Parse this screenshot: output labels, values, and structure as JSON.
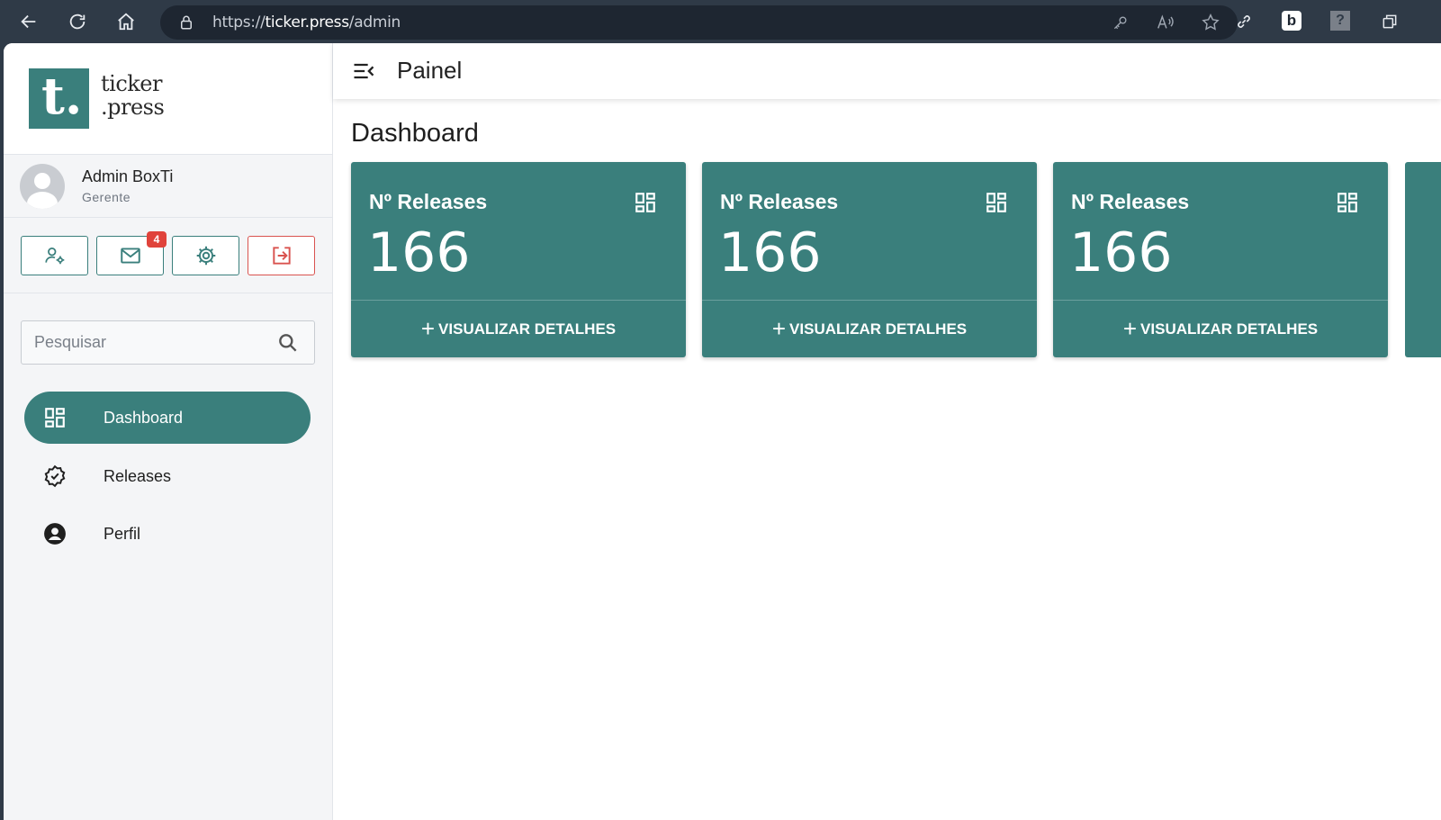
{
  "browser": {
    "url_prefix": "https://",
    "url_host": "ticker.press",
    "url_path": "/admin"
  },
  "brand": {
    "logo_letter": "t.",
    "name_line1": "ticker",
    "name_line2": ".press",
    "accent_color": "#3a7f7c"
  },
  "user": {
    "name": "Admin BoxTi",
    "role": "Gerente"
  },
  "actions": {
    "mail_badge": "4"
  },
  "search": {
    "placeholder": "Pesquisar"
  },
  "sidebar": {
    "items": [
      {
        "label": "Dashboard",
        "icon": "dashboard-icon",
        "active": true
      },
      {
        "label": "Releases",
        "icon": "verified-badge-icon",
        "active": false
      },
      {
        "label": "Perfil",
        "icon": "account-circle-icon",
        "active": false
      }
    ]
  },
  "header": {
    "title": "Painel"
  },
  "main": {
    "page_title": "Dashboard",
    "cards": [
      {
        "title": "Nº Releases",
        "value": "166",
        "footer": "VISUALIZAR DETALHES"
      },
      {
        "title": "Nº Releases",
        "value": "166",
        "footer": "VISUALIZAR DETALHES"
      },
      {
        "title": "Nº Releases",
        "value": "166",
        "footer": "VISUALIZAR DETALHES"
      }
    ]
  }
}
